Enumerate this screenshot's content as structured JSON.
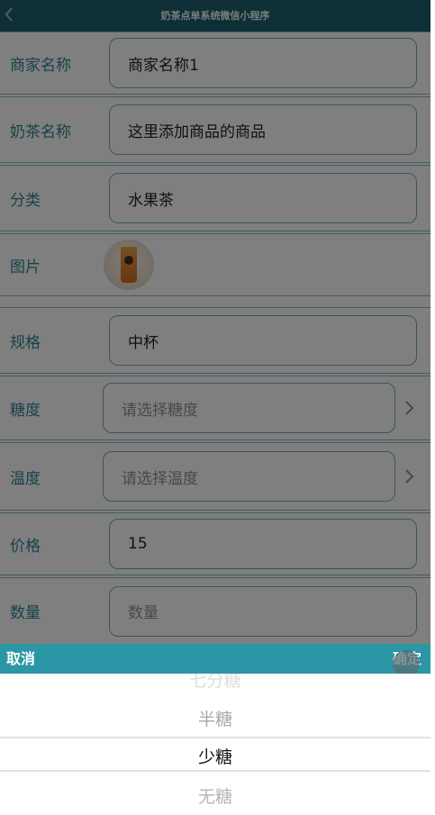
{
  "nav": {
    "title": "奶茶点单系统微信小程序",
    "back_icon": "chevron-left-icon"
  },
  "form": {
    "merchant": {
      "label": "商家名称",
      "value": "商家名称1"
    },
    "tea_name": {
      "label": "奶茶名称",
      "value": "这里添加商品的商品"
    },
    "category": {
      "label": "分类",
      "value": "水果茶"
    },
    "image": {
      "label": "图片"
    },
    "spec": {
      "label": "规格",
      "value": "中杯"
    },
    "sugar": {
      "label": "糖度",
      "placeholder": "请选择糖度"
    },
    "temperature": {
      "label": "温度",
      "placeholder": "请选择温度"
    },
    "price": {
      "label": "价格",
      "value": "15"
    },
    "quantity": {
      "label": "数量",
      "placeholder": "数量"
    }
  },
  "picker": {
    "cancel_label": "取消",
    "confirm_label": "确定",
    "options": [
      "七分糖",
      "半糖",
      "少糖",
      "无糖"
    ],
    "selected": "少糖"
  },
  "colors": {
    "nav_bg": "#1a5a66",
    "label_text": "#2d7f8a",
    "picker_bar": "#2b96a5"
  }
}
